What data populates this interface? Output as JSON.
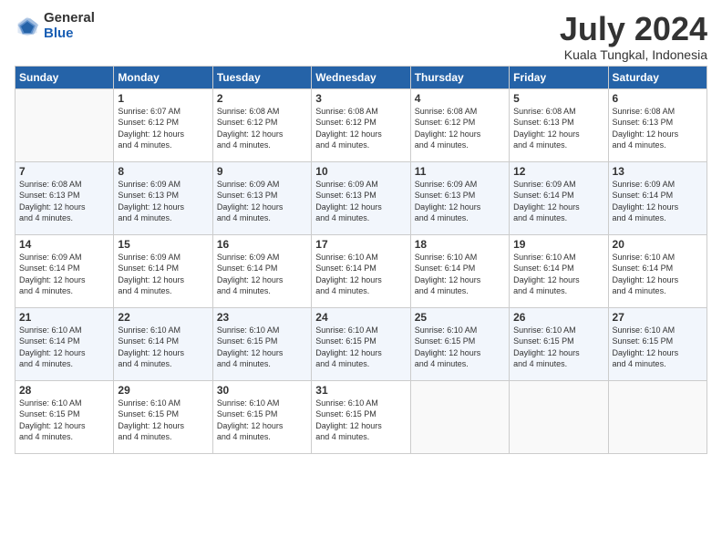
{
  "header": {
    "logo_general": "General",
    "logo_blue": "Blue",
    "title": "July 2024",
    "subtitle": "Kuala Tungkal, Indonesia"
  },
  "days_of_week": [
    "Sunday",
    "Monday",
    "Tuesday",
    "Wednesday",
    "Thursday",
    "Friday",
    "Saturday"
  ],
  "weeks": [
    [
      {
        "day": "",
        "info": ""
      },
      {
        "day": "1",
        "info": "Sunrise: 6:07 AM\nSunset: 6:12 PM\nDaylight: 12 hours\nand 4 minutes."
      },
      {
        "day": "2",
        "info": "Sunrise: 6:08 AM\nSunset: 6:12 PM\nDaylight: 12 hours\nand 4 minutes."
      },
      {
        "day": "3",
        "info": "Sunrise: 6:08 AM\nSunset: 6:12 PM\nDaylight: 12 hours\nand 4 minutes."
      },
      {
        "day": "4",
        "info": "Sunrise: 6:08 AM\nSunset: 6:12 PM\nDaylight: 12 hours\nand 4 minutes."
      },
      {
        "day": "5",
        "info": "Sunrise: 6:08 AM\nSunset: 6:13 PM\nDaylight: 12 hours\nand 4 minutes."
      },
      {
        "day": "6",
        "info": "Sunrise: 6:08 AM\nSunset: 6:13 PM\nDaylight: 12 hours\nand 4 minutes."
      }
    ],
    [
      {
        "day": "7",
        "info": "Sunrise: 6:08 AM\nSunset: 6:13 PM\nDaylight: 12 hours\nand 4 minutes."
      },
      {
        "day": "8",
        "info": "Sunrise: 6:09 AM\nSunset: 6:13 PM\nDaylight: 12 hours\nand 4 minutes."
      },
      {
        "day": "9",
        "info": "Sunrise: 6:09 AM\nSunset: 6:13 PM\nDaylight: 12 hours\nand 4 minutes."
      },
      {
        "day": "10",
        "info": "Sunrise: 6:09 AM\nSunset: 6:13 PM\nDaylight: 12 hours\nand 4 minutes."
      },
      {
        "day": "11",
        "info": "Sunrise: 6:09 AM\nSunset: 6:13 PM\nDaylight: 12 hours\nand 4 minutes."
      },
      {
        "day": "12",
        "info": "Sunrise: 6:09 AM\nSunset: 6:14 PM\nDaylight: 12 hours\nand 4 minutes."
      },
      {
        "day": "13",
        "info": "Sunrise: 6:09 AM\nSunset: 6:14 PM\nDaylight: 12 hours\nand 4 minutes."
      }
    ],
    [
      {
        "day": "14",
        "info": "Sunrise: 6:09 AM\nSunset: 6:14 PM\nDaylight: 12 hours\nand 4 minutes."
      },
      {
        "day": "15",
        "info": "Sunrise: 6:09 AM\nSunset: 6:14 PM\nDaylight: 12 hours\nand 4 minutes."
      },
      {
        "day": "16",
        "info": "Sunrise: 6:09 AM\nSunset: 6:14 PM\nDaylight: 12 hours\nand 4 minutes."
      },
      {
        "day": "17",
        "info": "Sunrise: 6:10 AM\nSunset: 6:14 PM\nDaylight: 12 hours\nand 4 minutes."
      },
      {
        "day": "18",
        "info": "Sunrise: 6:10 AM\nSunset: 6:14 PM\nDaylight: 12 hours\nand 4 minutes."
      },
      {
        "day": "19",
        "info": "Sunrise: 6:10 AM\nSunset: 6:14 PM\nDaylight: 12 hours\nand 4 minutes."
      },
      {
        "day": "20",
        "info": "Sunrise: 6:10 AM\nSunset: 6:14 PM\nDaylight: 12 hours\nand 4 minutes."
      }
    ],
    [
      {
        "day": "21",
        "info": "Sunrise: 6:10 AM\nSunset: 6:14 PM\nDaylight: 12 hours\nand 4 minutes."
      },
      {
        "day": "22",
        "info": "Sunrise: 6:10 AM\nSunset: 6:14 PM\nDaylight: 12 hours\nand 4 minutes."
      },
      {
        "day": "23",
        "info": "Sunrise: 6:10 AM\nSunset: 6:15 PM\nDaylight: 12 hours\nand 4 minutes."
      },
      {
        "day": "24",
        "info": "Sunrise: 6:10 AM\nSunset: 6:15 PM\nDaylight: 12 hours\nand 4 minutes."
      },
      {
        "day": "25",
        "info": "Sunrise: 6:10 AM\nSunset: 6:15 PM\nDaylight: 12 hours\nand 4 minutes."
      },
      {
        "day": "26",
        "info": "Sunrise: 6:10 AM\nSunset: 6:15 PM\nDaylight: 12 hours\nand 4 minutes."
      },
      {
        "day": "27",
        "info": "Sunrise: 6:10 AM\nSunset: 6:15 PM\nDaylight: 12 hours\nand 4 minutes."
      }
    ],
    [
      {
        "day": "28",
        "info": "Sunrise: 6:10 AM\nSunset: 6:15 PM\nDaylight: 12 hours\nand 4 minutes."
      },
      {
        "day": "29",
        "info": "Sunrise: 6:10 AM\nSunset: 6:15 PM\nDaylight: 12 hours\nand 4 minutes."
      },
      {
        "day": "30",
        "info": "Sunrise: 6:10 AM\nSunset: 6:15 PM\nDaylight: 12 hours\nand 4 minutes."
      },
      {
        "day": "31",
        "info": "Sunrise: 6:10 AM\nSunset: 6:15 PM\nDaylight: 12 hours\nand 4 minutes."
      },
      {
        "day": "",
        "info": ""
      },
      {
        "day": "",
        "info": ""
      },
      {
        "day": "",
        "info": ""
      }
    ]
  ]
}
